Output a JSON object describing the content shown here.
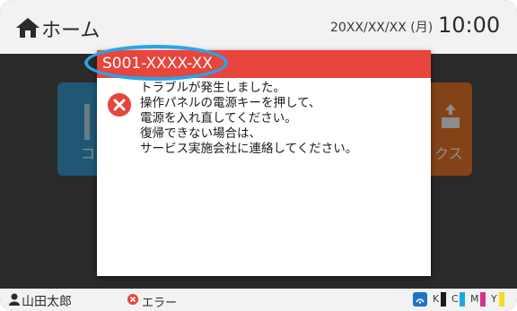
{
  "header": {
    "title": "ホーム",
    "date": "20XX/XX/XX (月)",
    "time": "10:00",
    "home_icon": "home-icon"
  },
  "background_tiles": {
    "left_label": "コ",
    "right_label": "クス"
  },
  "dialog": {
    "error_code": "S001-XXXX-XX",
    "icon": "error-x-icon",
    "message_lines": [
      "トラブルが発生しました。",
      "操作パネルの電源キーを押して、",
      "電源を入れ直してください。",
      "復帰できない場合は、",
      "サービス実施会社に連絡してください。"
    ]
  },
  "status_bar": {
    "user": "山田太郎",
    "status": "エラー",
    "inks": [
      {
        "label": "K",
        "color": "#1a1a1a"
      },
      {
        "label": "C",
        "color": "#17a9e6"
      },
      {
        "label": "M",
        "color": "#d6338f"
      },
      {
        "label": "Y",
        "color": "#f2df1f"
      }
    ]
  },
  "colors": {
    "accent_red": "#e8453c",
    "highlight_ring": "#2aa3e6"
  }
}
